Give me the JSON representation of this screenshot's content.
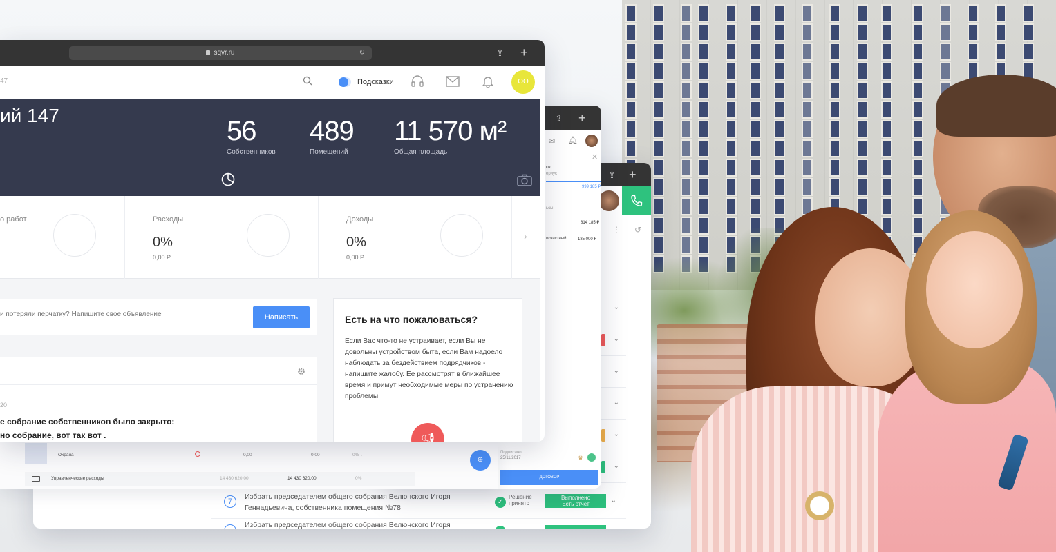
{
  "browser": {
    "url": "sqvr.ru"
  },
  "topnav": {
    "crumb": "47",
    "hints_label": "Подсказки",
    "avatar_initials": "ОО"
  },
  "hero": {
    "title": "ий 147",
    "stats": [
      {
        "value": "56",
        "label": "Собственников"
      },
      {
        "value": "489",
        "label": "Помещений"
      },
      {
        "value": "11 570 м²",
        "label": "Общая площадь"
      }
    ]
  },
  "cards": [
    {
      "title": "о работ",
      "percent": "",
      "amount": ""
    },
    {
      "title": "Расходы",
      "percent": "0%",
      "amount": "0,00 Р"
    },
    {
      "title": "Доходы",
      "percent": "0%",
      "amount": "0,00 Р"
    }
  ],
  "post": {
    "placeholder": "и потеряли перчатку? Напишите свое объявление",
    "button": "Написать"
  },
  "feed": {
    "date": "20",
    "line1": "е собрание собственников было закрыто:",
    "line2": "но собрание, вот так вот ."
  },
  "complain": {
    "title": "Есть на что пожаловаться?",
    "body": "Если Вас что-то не устраивает, если Вы не довольны устройством быта, если Вам надоело наблюдать за бездействием подрядчиков - напишите жалобу. Ее рассмотрят в ближайшее время и примут необходимые меры по устранению проблемы"
  },
  "win2": {
    "header_short": "ок",
    "header_sub": "ериус",
    "amount1": "999 185 ₽",
    "row1_label": "ьсы",
    "row1_value": "814 185 ₽",
    "row2_label": "осчистный",
    "row2_value": "185 000 ₽",
    "date_label": "Подписано",
    "date_value": "25/11/2017",
    "contract_button": "ДОГОВОР"
  },
  "budget_rows": [
    {
      "name": "Охрана",
      "col1": "0,00",
      "col2": "0,00",
      "col3": "0% ↓"
    },
    {
      "name": "Управленческие расходы",
      "col1": "14 430 620,00",
      "col2": "14 430 620,00",
      "col3": "0%"
    }
  ],
  "agenda": [
    {
      "num": "7",
      "text": "Избрать председателем общего собрания Велюнского Игоря Геннадьевича, собственника помещения №78",
      "decision": "Решение принято",
      "status_line1": "Выполнено",
      "status_line2": "Есть отчет"
    },
    {
      "num": "",
      "text": "Избрать председателем общего собрания Велюнского Игоря",
      "decision": "",
      "status_line1": "",
      "status_line2": ""
    }
  ],
  "colors": {
    "accent_blue": "#4a8ff7",
    "hero_bg": "#353a4e",
    "success_green": "#2ec27e",
    "alert_red": "#ef5a5a",
    "avatar_yellow": "#e8e63a"
  }
}
